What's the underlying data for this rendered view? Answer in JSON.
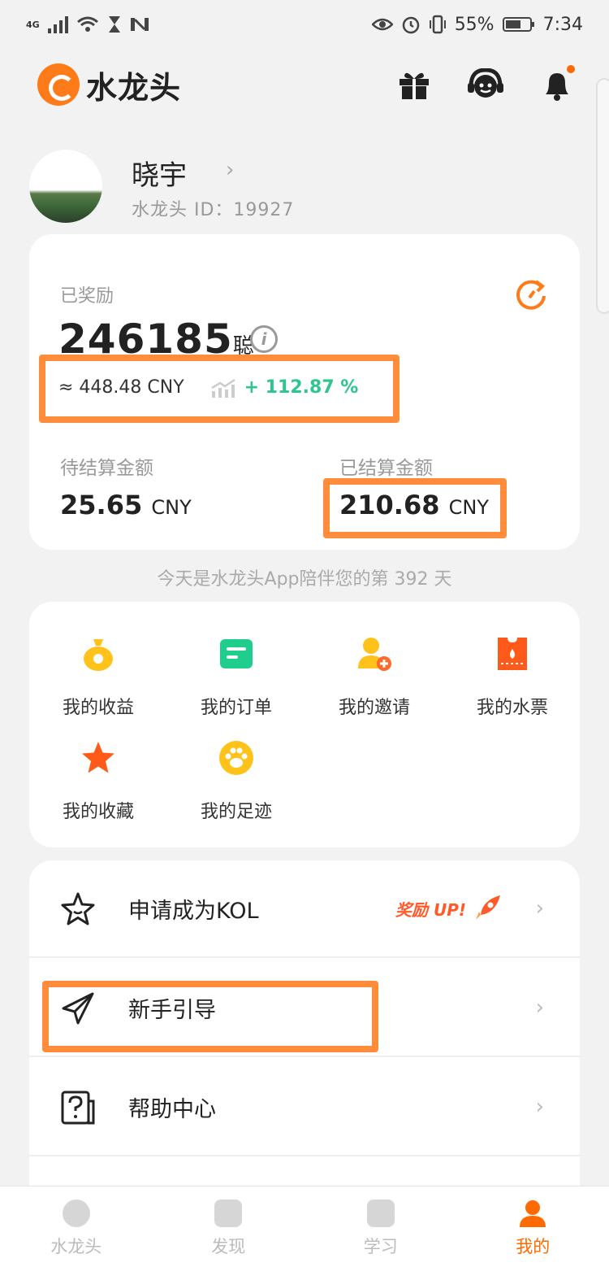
{
  "status": {
    "network": "4G",
    "battery": "55%",
    "time": "7:34"
  },
  "header": {
    "app_name": "水龙头",
    "icons": [
      "gift-icon",
      "support-icon",
      "bell-icon"
    ],
    "accent": "#ff7a18"
  },
  "profile": {
    "name": "晓宇",
    "id_text": "水龙头 ID：19927"
  },
  "rewards": {
    "label": "已奖励",
    "amount": "246185",
    "unit": "聪",
    "approx": "≈ 448.48 CNY",
    "growth": "+ 112.87 %",
    "pending_label": "待结算金额",
    "pending_value": "25.65",
    "pending_unit": "CNY",
    "settled_label": "已结算金额",
    "settled_value": "210.68",
    "settled_unit": "CNY"
  },
  "days_text": "今天是水龙头App陪伴您的第 392 天",
  "menu": [
    {
      "label": "我的收益",
      "icon": "money-bag-icon"
    },
    {
      "label": "我的订单",
      "icon": "order-icon"
    },
    {
      "label": "我的邀请",
      "icon": "invite-icon"
    },
    {
      "label": "我的水票",
      "icon": "ticket-icon"
    },
    {
      "label": "我的收藏",
      "icon": "star-icon"
    },
    {
      "label": "我的足迹",
      "icon": "paw-icon"
    }
  ],
  "list": {
    "kol": "申请成为KOL",
    "kol_badge": "奖励 UP!",
    "guide": "新手引导",
    "help": "帮助中心"
  },
  "tabs": [
    {
      "label": "水龙头",
      "active": false
    },
    {
      "label": "发现",
      "active": false
    },
    {
      "label": "学习",
      "active": false
    },
    {
      "label": "我的",
      "active": true
    }
  ],
  "colors": {
    "highlight": "#ff8c3a",
    "growth": "#2ec58e",
    "active_tab": "#ff6a00"
  }
}
